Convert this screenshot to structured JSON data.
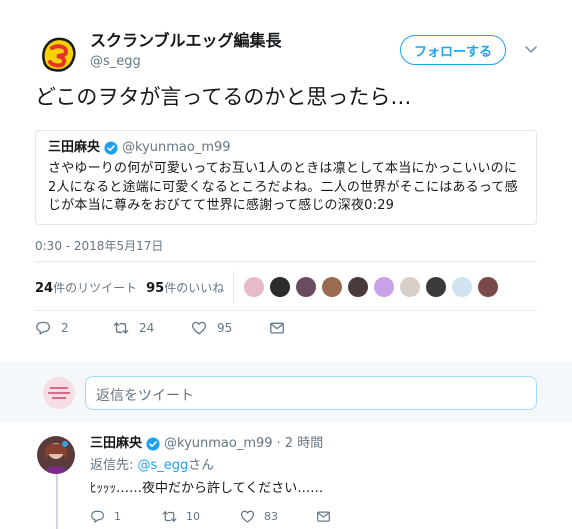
{
  "author": {
    "display_name": "スクランブルエッグ編集長",
    "handle": "@s_egg"
  },
  "follow_label": "フォローする",
  "tweet_text": "どこのヲタが言ってるのかと思ったら…",
  "quoted": {
    "name": "三田麻央",
    "handle": "@kyunmao_m99",
    "text": "さやゆーりの何が可愛いってお互い1人のときは凛として本当にかっこいいのに2人になると途端に可愛くなるところだよね。二人の世界がそこにはあるって感じが本当に尊みをおびてて世界に感謝って感じの深夜0:29"
  },
  "timestamp": "0:30 - 2018年5月17日",
  "stats": {
    "retweets_count": "24",
    "retweets_label": "件のリツイート",
    "likes_count": "95",
    "likes_label": "件のいいね"
  },
  "liker_colors": [
    "#e8b9c6",
    "#2b2b2b",
    "#6b4b5e",
    "#9a6b4f",
    "#4a3a3a",
    "#c9a2e8",
    "#d8d0c8",
    "#3a3a3a",
    "#cfe3f0",
    "#7a4a4a"
  ],
  "actions": {
    "reply_count": "2",
    "retweet_count": "24",
    "like_count": "95"
  },
  "reply_box": {
    "placeholder": "返信をツイート"
  },
  "reply": {
    "name": "三田麻央",
    "handle": "@kyunmao_m99",
    "time": "· 2 時間",
    "to_prefix": "返信先: ",
    "to_mention": "@s_egg",
    "to_suffix": "さん",
    "text": "ﾋｯｯｯ……夜中だから許してください……",
    "reply_count": "1",
    "retweet_count": "10",
    "like_count": "83"
  },
  "colors": {
    "accent": "#1da1f2",
    "muted": "#657786",
    "text": "#14171a"
  }
}
